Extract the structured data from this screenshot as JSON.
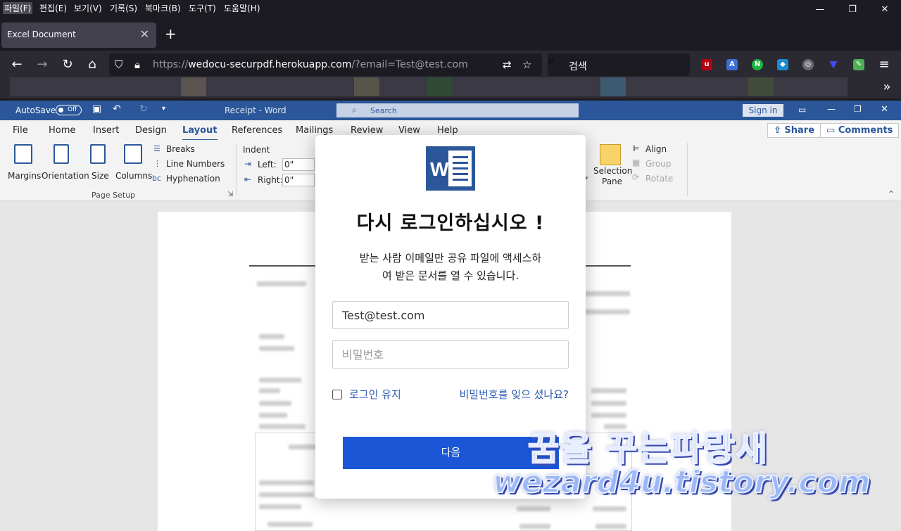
{
  "menubar": {
    "items": [
      "파일(F)",
      "편집(E)",
      "보기(V)",
      "기록(S)",
      "북마크(B)",
      "도구(T)",
      "도움말(H)"
    ]
  },
  "window_controls": {
    "minimize": "—",
    "restore": "❐",
    "close": "✕"
  },
  "tab": {
    "title": "Excel Document",
    "close": "✕",
    "new_tab": "+"
  },
  "navbar": {
    "url_scheme": "https://",
    "url_host": "wedocu-securpdf.herokuapp.com",
    "url_path": "/?email=Test@test.com",
    "search_placeholder": "검색",
    "overflow": "»",
    "menu": "≡"
  },
  "word": {
    "autosave_label": "AutoSave",
    "autosave_state": "Off",
    "doc_title": "Receipt  -  Word",
    "search_label": "Search",
    "signin_label": "Sign in",
    "share_label": "Share",
    "comments_label": "Comments",
    "ribbon_tabs": [
      "File",
      "Home",
      "Insert",
      "Design",
      "Layout",
      "References",
      "Mailings",
      "Review",
      "View",
      "Help"
    ],
    "active_tab": "Layout",
    "buttons": {
      "margins": "Margins",
      "orientation": "Orientation",
      "size": "Size",
      "columns": "Columns",
      "breaks": "Breaks",
      "line_numbers": "Line Numbers",
      "hyphenation": "Hyphenation",
      "indent": "Indent",
      "left": "Left:",
      "right": "Right:",
      "left_value": "0\"",
      "right_value": "0\"",
      "selection_pane_1": "Selection",
      "selection_pane_2": "Pane",
      "align": "Align",
      "group": "Group",
      "rotate": "Rotate"
    },
    "page_setup_label": "Page Setup"
  },
  "login": {
    "title": "다시 로그인하십시오 !",
    "description_line1": "받는 사람 이메일만 공유 파일에 액세스하",
    "description_line2": "여 받은 문서를 열 수 있습니다.",
    "email_value": "Test@test.com",
    "password_placeholder": "비밀번호",
    "remember_label": "로그인 유지",
    "forgot_label": "비밀번호를 잊으 셨나요?",
    "next_label": "다음",
    "brand_color": "#1a56d6"
  },
  "watermark": {
    "line1": "꿈을 꾸는파랑새",
    "line2": "wezard4u.tistory.com"
  },
  "colors": {
    "word_blue": "#2b579a",
    "firefox_dark": "#1c1b22"
  }
}
